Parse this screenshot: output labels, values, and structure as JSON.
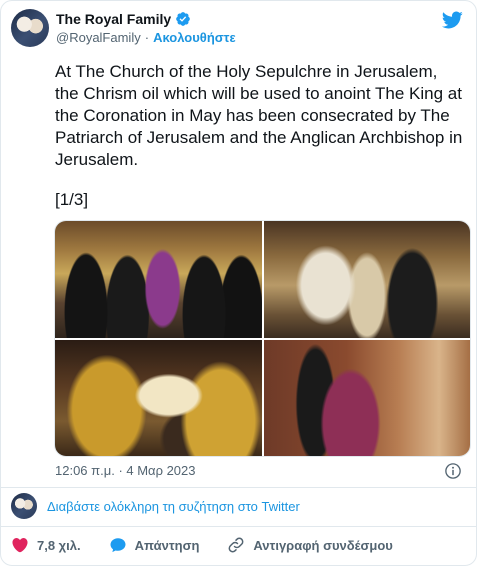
{
  "header": {
    "display_name": "The Royal Family",
    "handle": "@RoyalFamily",
    "separator": "·",
    "follow_label": "Ακολουθήστε",
    "verified_icon": "verified-badge-icon",
    "brand_icon": "twitter-bird-icon"
  },
  "tweet": {
    "text": "At The Church of the Holy Sepulchre in Jerusalem, the Chrism oil which will be used to anoint The King at the Coronation in May has been consecrated by The Patriarch of Jerusalem and the Anglican Archbishop in Jerusalem.",
    "page_marker": "[1/3]",
    "timestamp": "12:06 π.μ. · 4 Μαρ 2023"
  },
  "thread": {
    "link_label": "Διαβάστε ολόκληρη τη συζήτηση στο Twitter"
  },
  "actions": {
    "like_count": "7,8 χιλ.",
    "reply_label": "Απάντηση",
    "copy_link_label": "Αντιγραφή συνδέσμου"
  },
  "colors": {
    "accent": "#1b95e0",
    "heart": "#e0245e",
    "muted": "#536471",
    "border": "#e1e8ed"
  }
}
